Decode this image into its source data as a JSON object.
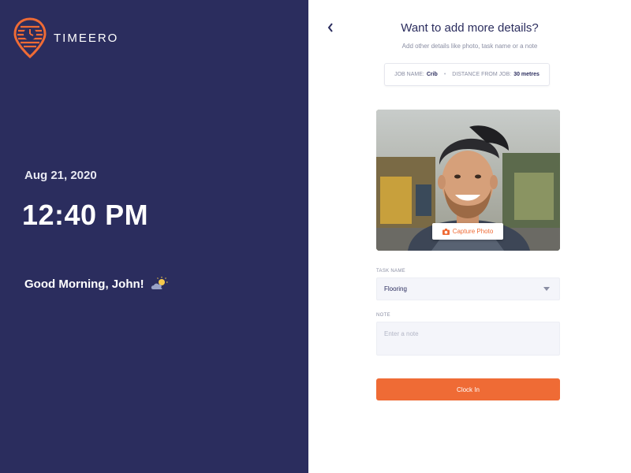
{
  "brand": {
    "name": "TIMEERO",
    "logo_icon": "clock-pin-logo",
    "accent": "#ef6b35"
  },
  "left": {
    "date": "Aug 21, 2020",
    "time": "12:40 PM",
    "greeting": "Good Morning, John!",
    "weather_icon": "partly-cloudy-icon",
    "background": "#2b2d5e"
  },
  "right": {
    "back_icon": "chevron-left-icon",
    "title": "Want to add more details?",
    "subtitle": "Add other details like photo, task name or a note",
    "job": {
      "name_label": "JOB NAME:",
      "name_value": "Crib",
      "separator": "•",
      "distance_label": "DISTANCE FROM JOB:",
      "distance_value": "30 metres"
    },
    "photo": {
      "capture_label": "Capture Photo",
      "capture_icon": "camera-icon"
    },
    "task": {
      "label": "TASK NAME",
      "value": "Flooring",
      "caret_icon": "chevron-down-icon"
    },
    "note": {
      "label": "NOTE",
      "placeholder": "Enter a note"
    },
    "clock_in_label": "Clock In"
  }
}
